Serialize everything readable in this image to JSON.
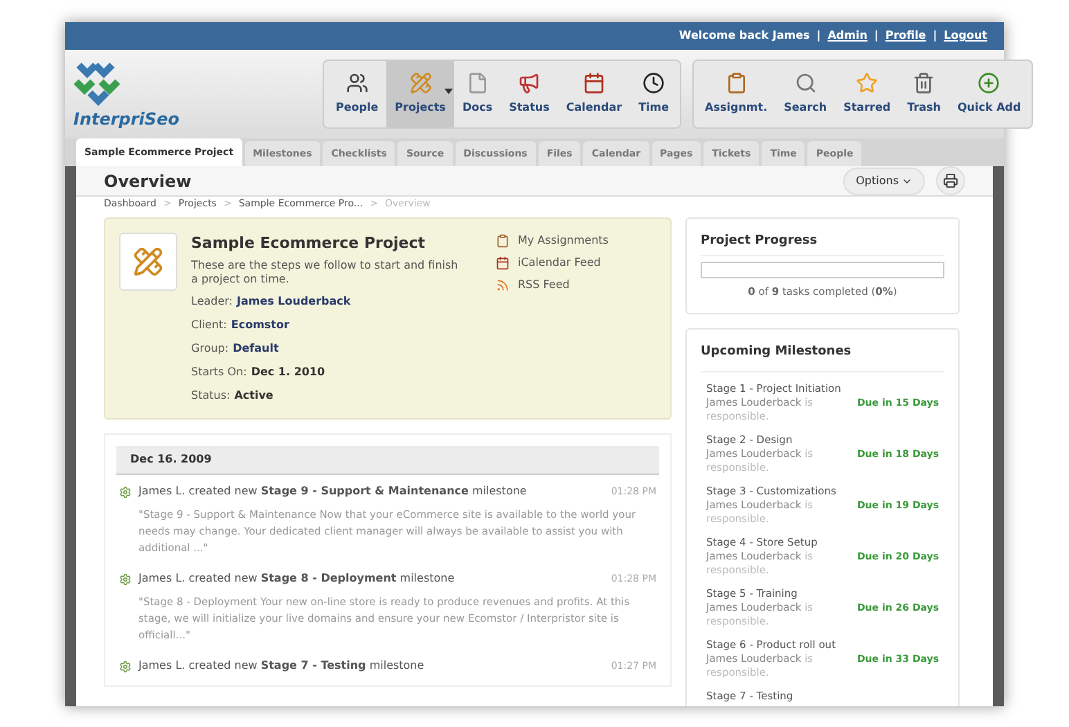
{
  "top_bar": {
    "welcome": "Welcome back James",
    "separator": "|",
    "links": [
      {
        "label": "Admin"
      },
      {
        "label": "Profile"
      },
      {
        "label": "Logout"
      }
    ]
  },
  "logo": {
    "text": "InterpriSeo"
  },
  "toolbar_groups": [
    {
      "items": [
        {
          "label": "People",
          "selected": false,
          "has_menu": false
        },
        {
          "label": "Projects",
          "selected": true,
          "has_menu": true
        },
        {
          "label": "Docs",
          "selected": false,
          "has_menu": false
        },
        {
          "label": "Status",
          "selected": false,
          "has_menu": false
        },
        {
          "label": "Calendar",
          "selected": false,
          "has_menu": false
        },
        {
          "label": "Time",
          "selected": false,
          "has_menu": false
        }
      ]
    },
    {
      "items": [
        {
          "label": "Assignmt.",
          "selected": false,
          "has_menu": false
        },
        {
          "label": "Search",
          "selected": false,
          "has_menu": false
        },
        {
          "label": "Starred",
          "selected": false,
          "has_menu": false
        },
        {
          "label": "Trash",
          "selected": false,
          "has_menu": false
        },
        {
          "label": "Quick Add",
          "selected": false,
          "has_menu": false
        }
      ]
    }
  ],
  "tabs": [
    {
      "label": "Sample Ecommerce Project",
      "selected": true
    },
    {
      "label": "Milestones",
      "selected": false
    },
    {
      "label": "Checklists",
      "selected": false
    },
    {
      "label": "Source",
      "selected": false
    },
    {
      "label": "Discussions",
      "selected": false
    },
    {
      "label": "Files",
      "selected": false
    },
    {
      "label": "Calendar",
      "selected": false
    },
    {
      "label": "Pages",
      "selected": false
    },
    {
      "label": "Tickets",
      "selected": false
    },
    {
      "label": "Time",
      "selected": false
    },
    {
      "label": "People",
      "selected": false
    }
  ],
  "page_title": "Overview",
  "options_button": "Options",
  "breadcrumb_separator": ">",
  "breadcrumb": [
    {
      "label": "Dashboard",
      "current": false
    },
    {
      "label": "Projects",
      "current": false
    },
    {
      "label": "Sample Ecommerce Pro...",
      "current": false
    },
    {
      "label": "Overview",
      "current": true
    }
  ],
  "project": {
    "title": "Sample Ecommerce Project",
    "description": "These are the steps we follow to start and finish a project on time.",
    "fields": [
      {
        "label": "Leader:",
        "value": "James Louderback",
        "kind": "link"
      },
      {
        "label": "Client:",
        "value": "Ecomstor",
        "kind": "link"
      },
      {
        "label": "Group:",
        "value": "Default",
        "kind": "link"
      },
      {
        "label": "Starts On:",
        "value": "Dec 1. 2010",
        "kind": "plain"
      },
      {
        "label": "Status:",
        "value": "Active",
        "kind": "plain"
      }
    ],
    "links": [
      {
        "label": "My Assignments"
      },
      {
        "label": "iCalendar Feed"
      },
      {
        "label": "RSS Feed"
      }
    ]
  },
  "activity": {
    "date": "Dec 16. 2009",
    "items": [
      {
        "text": "James L. created new **Stage 9 - Support & Maintenance** milestone",
        "time": "01:28 PM",
        "excerpt": "\"Stage 9 - Support & Maintenance Now that your eCommerce site is available to the world your needs may change. Your dedicated client manager will always be available to assist you with additional ...\""
      },
      {
        "text": "James L. created new **Stage 8 - Deployment** milestone",
        "time": "01:28 PM",
        "excerpt": "\"Stage 8 - Deployment Your new on-line store is ready to produce revenues and profits. At this stage, we will initialize your live domains and ensure your new Ecomstor / Interpristor site is officiall...\""
      },
      {
        "text": "James L. created new **Stage 7 - Testing** milestone",
        "time": "01:27 PM"
      }
    ]
  },
  "progress": {
    "title": "Project Progress",
    "level": 0,
    "summary": "**0** of **9** tasks completed (**0%**)"
  },
  "milestones": {
    "title": "Upcoming Milestones",
    "items": [
      {
        "name": "Stage 1 - Project Initiation",
        "person": "James Louderback",
        "suffix": "is responsible.",
        "due": "Due in 15 Days"
      },
      {
        "name": "Stage 2 - Design",
        "person": "James Louderback",
        "suffix": "is responsible.",
        "due": "Due in 18 Days"
      },
      {
        "name": "Stage 3 - Customizations",
        "person": "James Louderback",
        "suffix": "is responsible.",
        "due": "Due in 19 Days"
      },
      {
        "name": "Stage 4 - Store Setup",
        "person": "James Louderback",
        "suffix": "is responsible.",
        "due": "Due in 20 Days"
      },
      {
        "name": "Stage 5 - Training",
        "person": "James Louderback",
        "suffix": "is responsible.",
        "due": "Due in 26 Days"
      },
      {
        "name": "Stage 6 - Product roll out",
        "person": "James Louderback",
        "suffix": "is responsible.",
        "due": "Due in 33 Days"
      },
      {
        "name": "Stage 7 - Testing"
      }
    ]
  }
}
